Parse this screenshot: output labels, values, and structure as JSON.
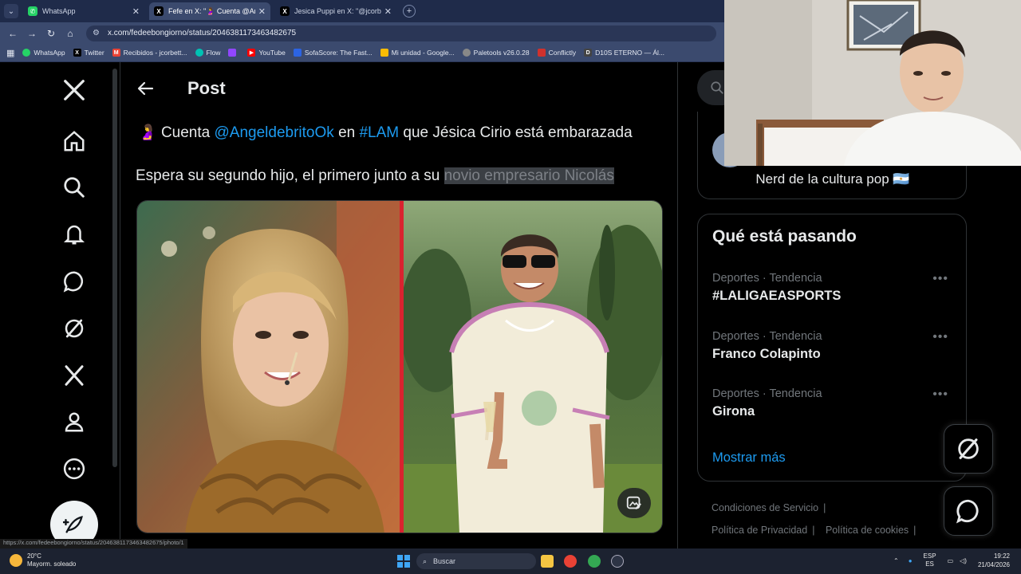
{
  "browser": {
    "tabs": [
      {
        "label": "WhatsApp",
        "active": false,
        "icon": "whatsapp-icon",
        "color": "#25d366"
      },
      {
        "label": "Fefe en X: \"🤰 Cuenta @Angelde",
        "active": true,
        "icon": "x-logo-icon",
        "color": "#000000"
      },
      {
        "label": "Jesica Puppi en X: \"@jcorbetta",
        "active": false,
        "icon": "x-logo-icon",
        "color": "#000000"
      }
    ],
    "new_tab_label": "+",
    "url": "x.com/fedeebongiorno/status/2046381173463482675",
    "bookmarks": [
      {
        "label": "WhatsApp",
        "icon": "whatsapp-icon",
        "color": "#25d366"
      },
      {
        "label": "Twitter",
        "icon": "x-logo-icon",
        "color": "#000000"
      },
      {
        "label": "Recibidos - jcorbett...",
        "icon": "gmail-icon",
        "color": "#ea4335"
      },
      {
        "label": "Flow",
        "icon": "flow-icon",
        "color": "#00c2b3"
      },
      {
        "label": "",
        "icon": "twitch-icon",
        "color": "#9146ff"
      },
      {
        "label": "YouTube",
        "icon": "youtube-icon",
        "color": "#ff0000"
      },
      {
        "label": "SofaScore: The Fast...",
        "icon": "sofascore-icon",
        "color": "#2c64e3"
      },
      {
        "label": "Mi unidad - Google...",
        "icon": "drive-icon",
        "color": "#fbbc04"
      },
      {
        "label": "Paletools v26.0.28",
        "icon": "paletools-icon",
        "color": "#888888"
      },
      {
        "label": "Conflictly",
        "icon": "conflictly-icon",
        "color": "#d0312d"
      },
      {
        "label": "D10S ETERNO — Ál...",
        "icon": "d10s-icon",
        "color": "#222222"
      }
    ],
    "status_url": "https://x.com/fedeebongiorno/status/2046381173463482675/photo/1"
  },
  "post": {
    "header_title": "Post",
    "line1": {
      "emoji": "🤰",
      "text_a": "Cuenta",
      "mention": "@AngeldebritoOk",
      "text_b": "en",
      "hashtag": "#LAM",
      "text_c": "que Jésica Cirio está embarazada"
    },
    "line2": {
      "text": "Espera su segundo hijo, el primero junto a su",
      "selected": "novio empresario Nicolás"
    }
  },
  "sidebar": {
    "profile_bio": "Nerd de la cultura pop 🇦🇷",
    "trends_title": "Qué está pasando",
    "trends": [
      {
        "meta": "Deportes · Tendencia",
        "name": "#LALIGAEASPORTS"
      },
      {
        "meta": "Deportes · Tendencia",
        "name": "Franco Colapinto"
      },
      {
        "meta": "Deportes · Tendencia",
        "name": "Girona"
      }
    ],
    "show_more": "Mostrar más",
    "footer": [
      "Condiciones de Servicio",
      "Política de Privacidad",
      "Política de cookies"
    ]
  },
  "taskbar": {
    "temperature": "20°C",
    "weather": "Mayorm. soleado",
    "search": "Buscar",
    "lang_top": "ESP",
    "lang_bottom": "ES",
    "time": "19:22",
    "date": "21/04/2026"
  },
  "colors": {
    "accent": "#1d9bf0",
    "background": "#000000",
    "divider": "#d9232f"
  }
}
